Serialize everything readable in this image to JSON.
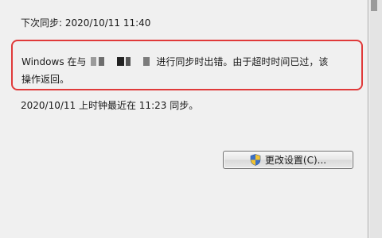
{
  "sync": {
    "next_sync": "下次同步: 2020/10/11 11:40",
    "error_prefix": "Windows 在与",
    "error_suffix": "进行同步时出错。由于超时时间已过，该",
    "error_line2": "操作返回。",
    "last_sync": "2020/10/11 上时钟最近在 11:23 同步。"
  },
  "buttons": {
    "change_settings": "更改设置(C)..."
  },
  "icons": {
    "button_icon": "uac-shield-icon"
  },
  "colors": {
    "highlight_border": "#e03a3a"
  }
}
